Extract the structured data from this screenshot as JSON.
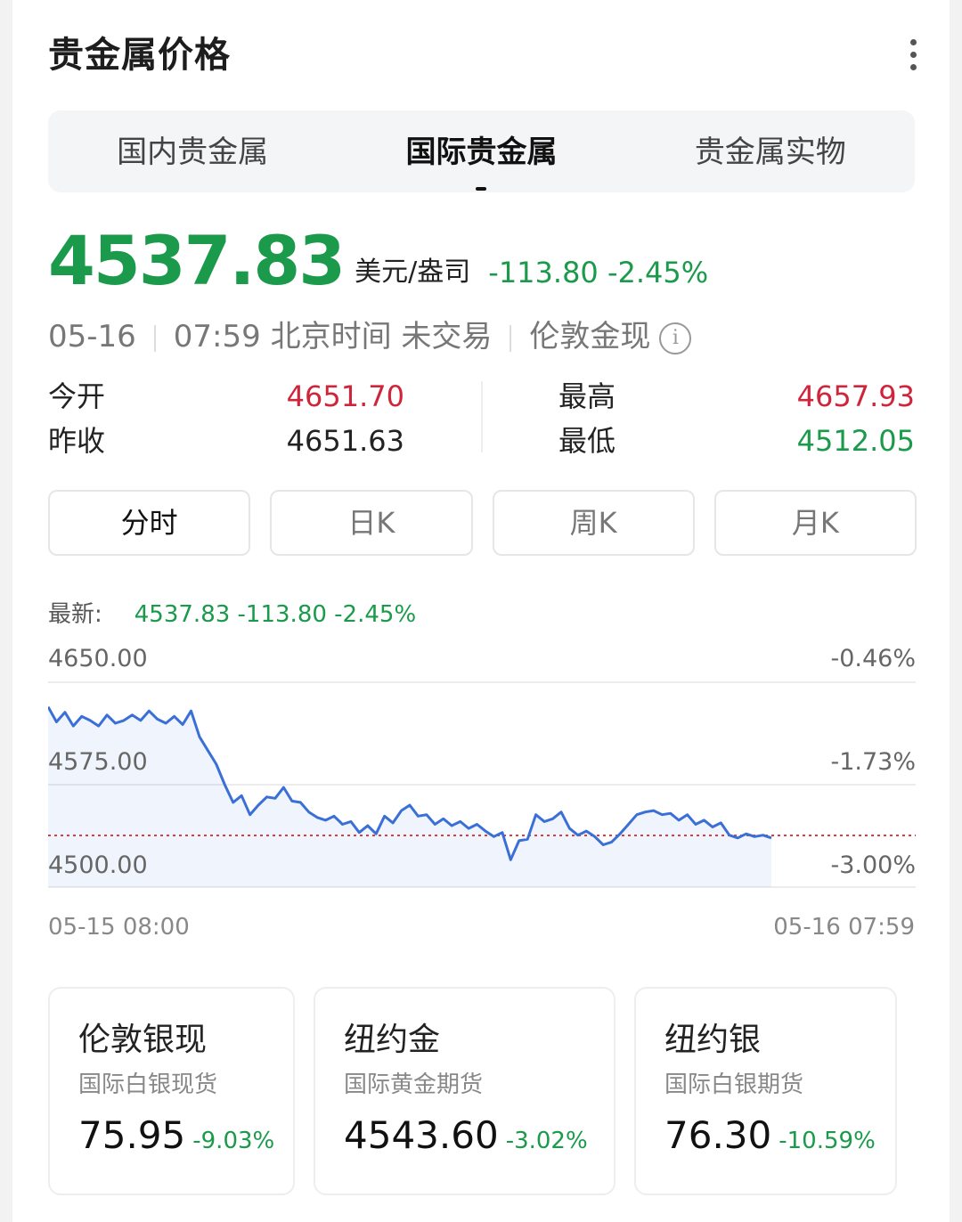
{
  "header": {
    "title": "贵金属价格",
    "more_icon": "more-vertical-icon"
  },
  "tabs": [
    {
      "label": "国内贵金属",
      "active": false
    },
    {
      "label": "国际贵金属",
      "active": true
    },
    {
      "label": "贵金属实物",
      "active": false
    }
  ],
  "quote": {
    "price": "4537.83",
    "unit": "美元/盎司",
    "change": "-113.80",
    "change_pct": "-2.45%",
    "date": "05-16",
    "time": "07:59 北京时间 未交易",
    "instrument": "伦敦金现"
  },
  "stats": {
    "open_label": "今开",
    "open": "4651.70",
    "prev_close_label": "昨收",
    "prev_close": "4651.63",
    "high_label": "最高",
    "high": "4657.93",
    "low_label": "最低",
    "low": "4512.05"
  },
  "periods": [
    {
      "label": "分时",
      "active": true
    },
    {
      "label": "日K",
      "active": false
    },
    {
      "label": "周K",
      "active": false
    },
    {
      "label": "月K",
      "active": false
    }
  ],
  "latest": {
    "label": "最新:",
    "value": "4537.83 -113.80 -2.45%"
  },
  "chart_data": {
    "type": "line",
    "y_ticks": [
      "4650.00",
      "4575.00",
      "4500.00"
    ],
    "y_pct_ticks": [
      "-0.46%",
      "-1.73%",
      "-3.00%"
    ],
    "ylim": [
      4500,
      4650
    ],
    "x_start": "05-15 08:00",
    "x_end": "05-16 07:59",
    "reference_line": 4537.83,
    "series": [
      {
        "values": [
          4632,
          4621,
          4628,
          4618,
          4625,
          4622,
          4618,
          4626,
          4620,
          4622,
          4626,
          4622,
          4629,
          4623,
          4620,
          4625,
          4619,
          4629,
          4610,
          4600,
          4590,
          4575,
          4562,
          4567,
          4553,
          4560,
          4566,
          4565,
          4573,
          4563,
          4562,
          4555,
          4551,
          4549,
          4552,
          4546,
          4548,
          4540,
          4545,
          4539,
          4552,
          4547,
          4556,
          4560,
          4552,
          4553,
          4546,
          4550,
          4545,
          4548,
          4543,
          4546,
          4541,
          4537,
          4540,
          4520,
          4534,
          4535,
          4553,
          4548,
          4550,
          4555,
          4543,
          4538,
          4541,
          4537,
          4531,
          4533,
          4539,
          4546,
          4553,
          4555,
          4556,
          4553,
          4554,
          4549,
          4553,
          4546,
          4549,
          4544,
          4547,
          4538,
          4536,
          4539,
          4537,
          4538,
          4536
        ]
      }
    ]
  },
  "cards": [
    {
      "title": "伦敦银现",
      "subtitle": "国际白银现货",
      "price": "75.95",
      "change": "-9.03%"
    },
    {
      "title": "纽约金",
      "subtitle": "国际黄金期货",
      "price": "4543.60",
      "change": "-3.02%"
    },
    {
      "title": "纽约银",
      "subtitle": "国际白银期货",
      "price": "76.30",
      "change": "-10.59%"
    }
  ],
  "colors": {
    "up_red": "#d0243a",
    "down_green": "#1a9a4a",
    "line_blue": "#3b6fd8",
    "ref_red": "#d64040"
  }
}
